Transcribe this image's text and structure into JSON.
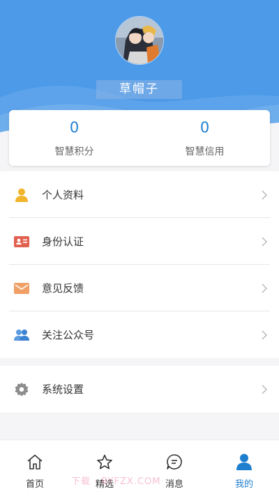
{
  "profile": {
    "username": "草帽子"
  },
  "stats": [
    {
      "value": "0",
      "label": "智慧积分"
    },
    {
      "value": "0",
      "label": "智慧信用"
    }
  ],
  "menu": {
    "items": [
      {
        "label": "个人资料",
        "icon": "person-icon"
      },
      {
        "label": "身份认证",
        "icon": "id-card-icon"
      },
      {
        "label": "意见反馈",
        "icon": "envelope-icon"
      },
      {
        "label": "关注公众号",
        "icon": "group-icon"
      }
    ],
    "settings": {
      "label": "系统设置",
      "icon": "gear-icon"
    }
  },
  "tabbar": {
    "tabs": [
      {
        "label": "首页",
        "icon": "home-icon"
      },
      {
        "label": "精选",
        "icon": "star-icon"
      },
      {
        "label": "消息",
        "icon": "message-icon"
      },
      {
        "label": "我的",
        "icon": "user-icon",
        "active": true
      }
    ]
  },
  "watermark": "下载 · BYFZX.COM",
  "colors": {
    "header_bg": "#4d9ae8",
    "accent": "#1f7fcf",
    "page_bg": "#f5f5f7"
  }
}
